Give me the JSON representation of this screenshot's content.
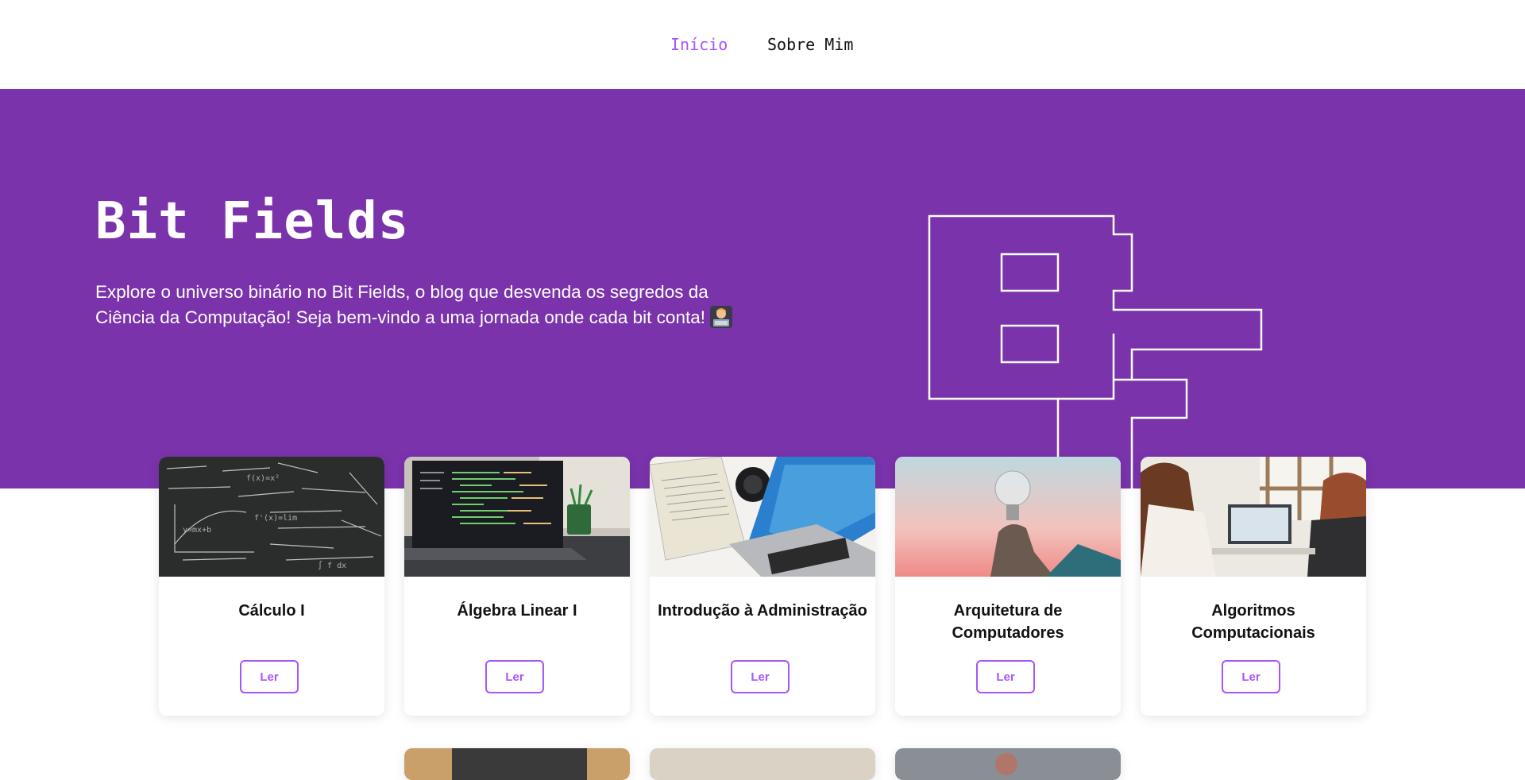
{
  "nav": {
    "items": [
      {
        "label": "Início",
        "active": true
      },
      {
        "label": "Sobre Mim",
        "active": false
      }
    ]
  },
  "hero": {
    "title": "Bit Fields",
    "description": "Explore o universo binário no Bit Fields, o blog que desvenda os segredos da Ciência da Computação! Seja bem-vindo a uma jornada onde cada bit conta!",
    "emoji_icon": "technologist-emoji-icon",
    "logo_icon": "bit-fields-logo-icon"
  },
  "cards": [
    {
      "title": "Cálculo I",
      "button": "Ler",
      "image_icon": "chalkboard-math-image"
    },
    {
      "title": "Álgebra Linear I",
      "button": "Ler",
      "image_icon": "laptop-code-image"
    },
    {
      "title": "Introdução à Administração",
      "button": "Ler",
      "image_icon": "laptop-desk-image"
    },
    {
      "title": "Arquitetura de Computadores",
      "button": "Ler",
      "image_icon": "lightbulb-image"
    },
    {
      "title": "Algoritmos Computacionais",
      "button": "Ler",
      "image_icon": "people-laptop-image"
    }
  ],
  "colors": {
    "brand_purple": "#7a33ab",
    "accent_purple": "#a855f7",
    "text_dark": "#111111"
  }
}
